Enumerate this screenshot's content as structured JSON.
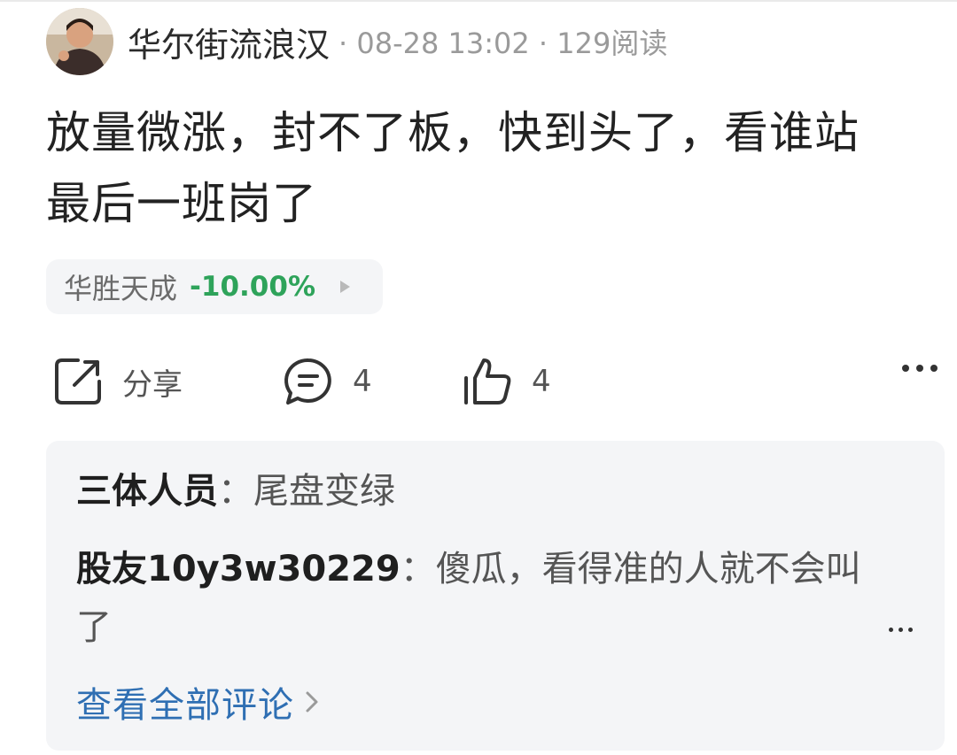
{
  "post": {
    "author": "华尔街流浪汉",
    "meta": "· 08-28 13:02 · 129阅读",
    "text_line1": "放量微涨，封不了板，快到头了，看谁站",
    "text_line2": "最后一班岗了",
    "stock": {
      "name": "华胜天成",
      "change": "-10.00%",
      "change_color": "#2ea35a"
    }
  },
  "actions": {
    "share_label": "分享",
    "comment_count": "4",
    "like_count": "4"
  },
  "comments": [
    {
      "author": "三体人员",
      "separator": "：",
      "text": "尾盘变绿"
    },
    {
      "author": "股友10y3w30229",
      "separator": "：",
      "text": "傻瓜，看得准的人就不会叫了"
    }
  ],
  "view_all_label": "查看全部评论",
  "colors": {
    "link": "#2f6fb3",
    "down": "#2ea35a"
  }
}
